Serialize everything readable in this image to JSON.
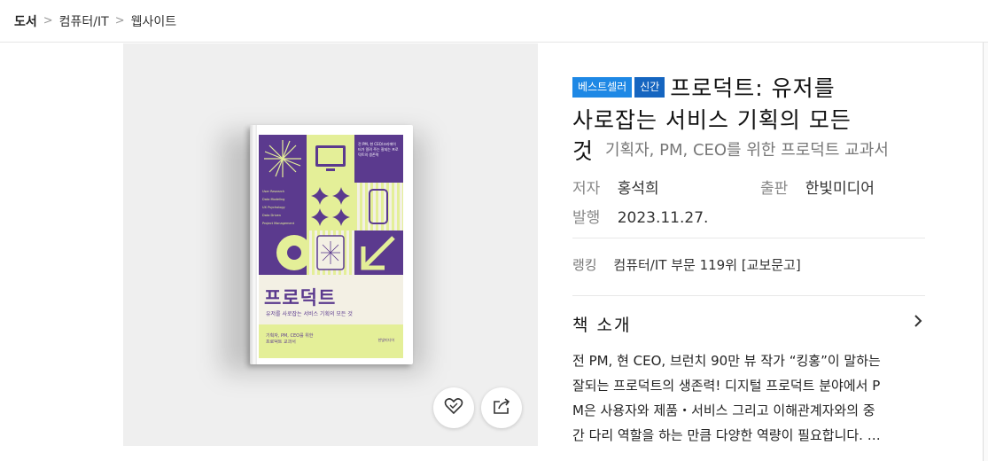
{
  "breadcrumb": [
    "도서",
    "컴퓨터/IT",
    "웹사이트"
  ],
  "book": {
    "badges": [
      "베스트셀러",
      "신간"
    ],
    "title_line1": "프로덕트: 유저를",
    "title_line2": "사로잡는 서비스 기획의 모든",
    "title_line3": "것",
    "subtitle": "기획자, PM, CEO를 위한 프로덕트 교과서",
    "author_label": "저자",
    "author": "홍석희",
    "publisher_label": "출판",
    "publisher": "한빛미디어",
    "date_label": "발행",
    "date": "2023.11.27.",
    "rank_label": "랭킹",
    "rank": "컴퓨터/IT 부문 119위 [교보문고]"
  },
  "cover": {
    "title": "프로덕트",
    "subtitle": "유저를 사로잡는 서비스 기획의 모든 것",
    "band_text_1": "기획자, PM, CEO를 위한",
    "band_text_2": "프로덕트 교과서",
    "publisher": "한빛미디어",
    "top_text": "전 PM, 현 CEO/크리에이터가 알려 주는 잘되는 프로덕트의 생존력",
    "menu": [
      "User Research",
      "Data Modeling",
      "UX Psychology",
      "Data Driven",
      "Project Management"
    ],
    "accent_colors": {
      "purple": "#5b3a8e",
      "lime": "#e4ef98"
    }
  },
  "actions": {
    "like_icon": "heart-icon",
    "share_icon": "share-icon"
  },
  "intro": {
    "heading": "책 소개",
    "text_line1": "전 PM, 현 CEO, 브런치 90만 뷰 작가 “킹홍”이 말하는",
    "text_line2": "잘되는 프로덕트의 생존력! 디지털 프로덕트 분야에서 P",
    "text_line3": "M은 사용자와 제품・서비스 그리고 이해관계자와의 중",
    "text_line4": "간 다리 역할을 하는 만큼 다양한 역량이 필요합니다. …"
  },
  "colors": {
    "badge_blue": "#1e88e5",
    "badge_blue_dark": "#1565c0"
  }
}
